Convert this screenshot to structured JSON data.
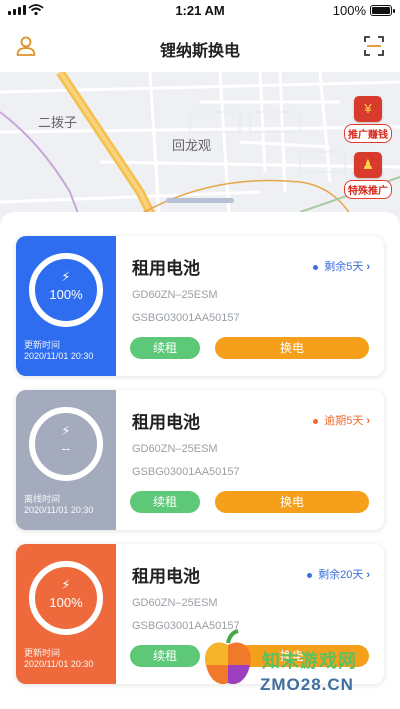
{
  "status_bar": {
    "time": "1:21 AM",
    "battery": "100%"
  },
  "nav": {
    "title": "锂纳斯换电",
    "left_icon": "user-icon",
    "right_icon": "scan-icon"
  },
  "map": {
    "places": [
      "二拨子",
      "回龙观"
    ],
    "promos": [
      {
        "label": "推广赚钱",
        "icon": "coin-gift-icon"
      },
      {
        "label": "特殊推广",
        "icon": "user-badge-icon"
      }
    ]
  },
  "batteries": [
    {
      "name": "租用电池",
      "status": "剩余5天",
      "model": "GD60ZN–25ESM",
      "serial": "GSBG03001AA50157",
      "charge": "100%",
      "time_label": "更新时间",
      "time": "2020/11/01 20:30",
      "renew_label": "续租",
      "swap_label": "换电",
      "status_color": "#3b6fe0",
      "panel_color": "#2f6df0"
    },
    {
      "name": "租用电池",
      "status": "逾期5天",
      "model": "GD60ZN–25ESM",
      "serial": "GSBG03001AA50157",
      "charge": "--",
      "time_label": "离线时间",
      "time": "2020/11/01 20:30",
      "renew_label": "续租",
      "swap_label": "换电",
      "status_color": "#f26b2c",
      "panel_color": "#a4abbd"
    },
    {
      "name": "租用电池",
      "status": "剩余20天",
      "model": "GD60ZN–25ESM",
      "serial": "GSBG03001AA50157",
      "charge": "100%",
      "time_label": "更新时间",
      "time": "2020/11/01 20:30",
      "renew_label": "续租",
      "swap_label": "换电",
      "status_color": "#3b6fe0",
      "panel_color": "#ee6a3c"
    }
  ],
  "watermark": {
    "line1": "知末游戏网",
    "line2": "ZMO28.CN"
  }
}
